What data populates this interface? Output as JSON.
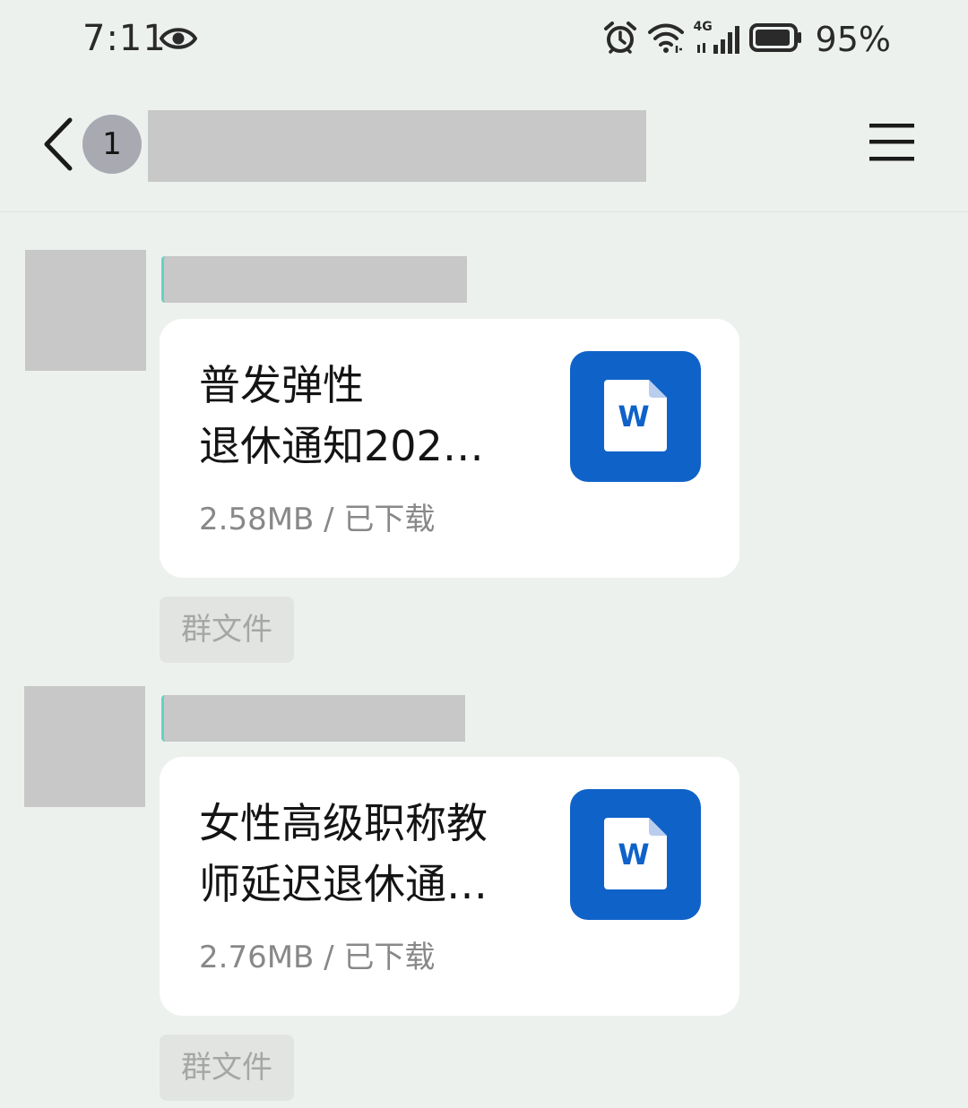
{
  "status_bar": {
    "time": "7:11",
    "network_label": "4G",
    "battery_percent": "95%",
    "battery_level": 0.95,
    "icons": [
      "eye-icon",
      "alarm-icon",
      "wifi-icon",
      "signal-icon",
      "battery-icon"
    ]
  },
  "nav": {
    "back_icon": "chevron-left-icon",
    "unread_count": "1",
    "menu_icon": "menu-icon"
  },
  "messages": [
    {
      "file_name_line1": "普发弹性",
      "file_name_line2": "退休通知202…",
      "file_meta": "2.58MB / 已下载",
      "file_icon": "word-doc-icon",
      "file_icon_letter": "W",
      "tag": "群文件"
    },
    {
      "file_name_line1": "女性高级职称教",
      "file_name_line2": "师延迟退休通…",
      "file_meta": "2.76MB / 已下载",
      "file_icon": "word-doc-icon",
      "file_icon_letter": "W",
      "tag": "群文件"
    }
  ],
  "colors": {
    "background": "#edf1ee",
    "card": "#ffffff",
    "word_blue": "#0f62c8",
    "redaction": "#c8c8c8",
    "badge": "#a8a9b1",
    "accent_teal": "#63d2c6"
  }
}
